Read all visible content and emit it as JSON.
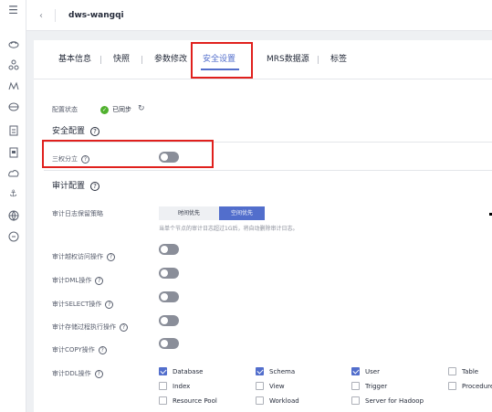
{
  "header": {
    "back_icon": "chevron-left-icon",
    "title": "dws-wangqi"
  },
  "rail_icons": [
    "menu-icon",
    "cloud-icon",
    "cluster-icon",
    "monitor-icon",
    "database-icon",
    "document-icon",
    "server-icon",
    "cloud-storage-icon",
    "anchor-icon",
    "globe-icon",
    "chat-icon"
  ],
  "tabs": [
    "基本信息",
    "快照",
    "参数修改",
    "安全设置",
    "MRS数据源",
    "标签"
  ],
  "active_tab": "安全设置",
  "config_status": {
    "label": "配置状态",
    "value": "已同步",
    "status_color": "#50b12e"
  },
  "security_section": {
    "title": "安全配置",
    "separation_label": "三权分立",
    "separation_enabled": false
  },
  "audit_section": {
    "title": "审计配置",
    "retention_label": "审计日志保留策略",
    "retention_options": [
      "时间优先",
      "空间优先"
    ],
    "retention_selected": "空间优先",
    "retention_hint": "当单个节点的审计日志超过1G后，将自动删除审计日志。",
    "toggles": [
      {
        "label": "审计越权访问操作",
        "enabled": false
      },
      {
        "label": "审计DML操作",
        "enabled": false
      },
      {
        "label": "审计SELECT操作",
        "enabled": false
      },
      {
        "label": "审计存储过程执行操作",
        "enabled": false
      },
      {
        "label": "审计COPY操作",
        "enabled": false
      }
    ],
    "ddl_label": "审计DDL操作",
    "ddl_options": [
      {
        "label": "Database",
        "checked": true
      },
      {
        "label": "Schema",
        "checked": true
      },
      {
        "label": "User",
        "checked": true
      },
      {
        "label": "Table",
        "checked": false
      },
      {
        "label": "Index",
        "checked": false
      },
      {
        "label": "View",
        "checked": false
      },
      {
        "label": "Trigger",
        "checked": false
      },
      {
        "label": "Procedure",
        "checked": false
      },
      {
        "label": "Resource Pool",
        "checked": false
      },
      {
        "label": "Workload",
        "checked": false
      },
      {
        "label": "Server for Hadoop",
        "checked": false
      }
    ]
  },
  "colors": {
    "accent": "#526ecc",
    "highlight": "#e0201d"
  }
}
